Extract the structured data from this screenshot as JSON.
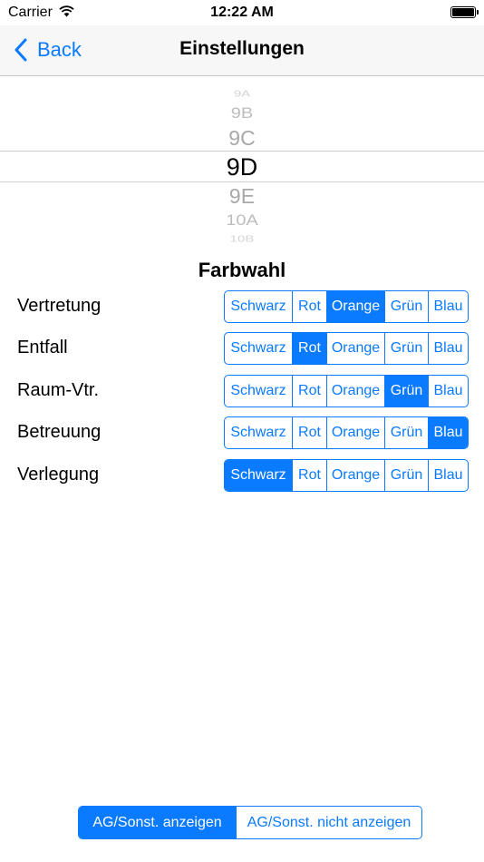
{
  "status_bar": {
    "carrier": "Carrier",
    "time": "12:22 AM"
  },
  "nav": {
    "back_label": "Back",
    "title": "Einstellungen"
  },
  "picker": {
    "items": [
      "9A",
      "9B",
      "9C",
      "9D",
      "9E",
      "10A",
      "10B"
    ],
    "selected": "9D"
  },
  "farbwahl": {
    "title": "Farbwahl",
    "options": [
      "Schwarz",
      "Rot",
      "Orange",
      "Grün",
      "Blau"
    ],
    "rows": [
      {
        "label": "Vertretung",
        "selected": "Orange"
      },
      {
        "label": "Entfall",
        "selected": "Rot"
      },
      {
        "label": "Raum-Vtr.",
        "selected": "Grün"
      },
      {
        "label": "Betreuung",
        "selected": "Blau"
      },
      {
        "label": "Verlegung",
        "selected": "Schwarz"
      }
    ]
  },
  "ag_toggle": {
    "options": [
      "AG/Sonst. anzeigen",
      "AG/Sonst. nicht anzeigen"
    ],
    "selected": "AG/Sonst. anzeigen"
  },
  "colors": {
    "accent": "#0a7aff",
    "nav_background": "#f7f7f8"
  }
}
